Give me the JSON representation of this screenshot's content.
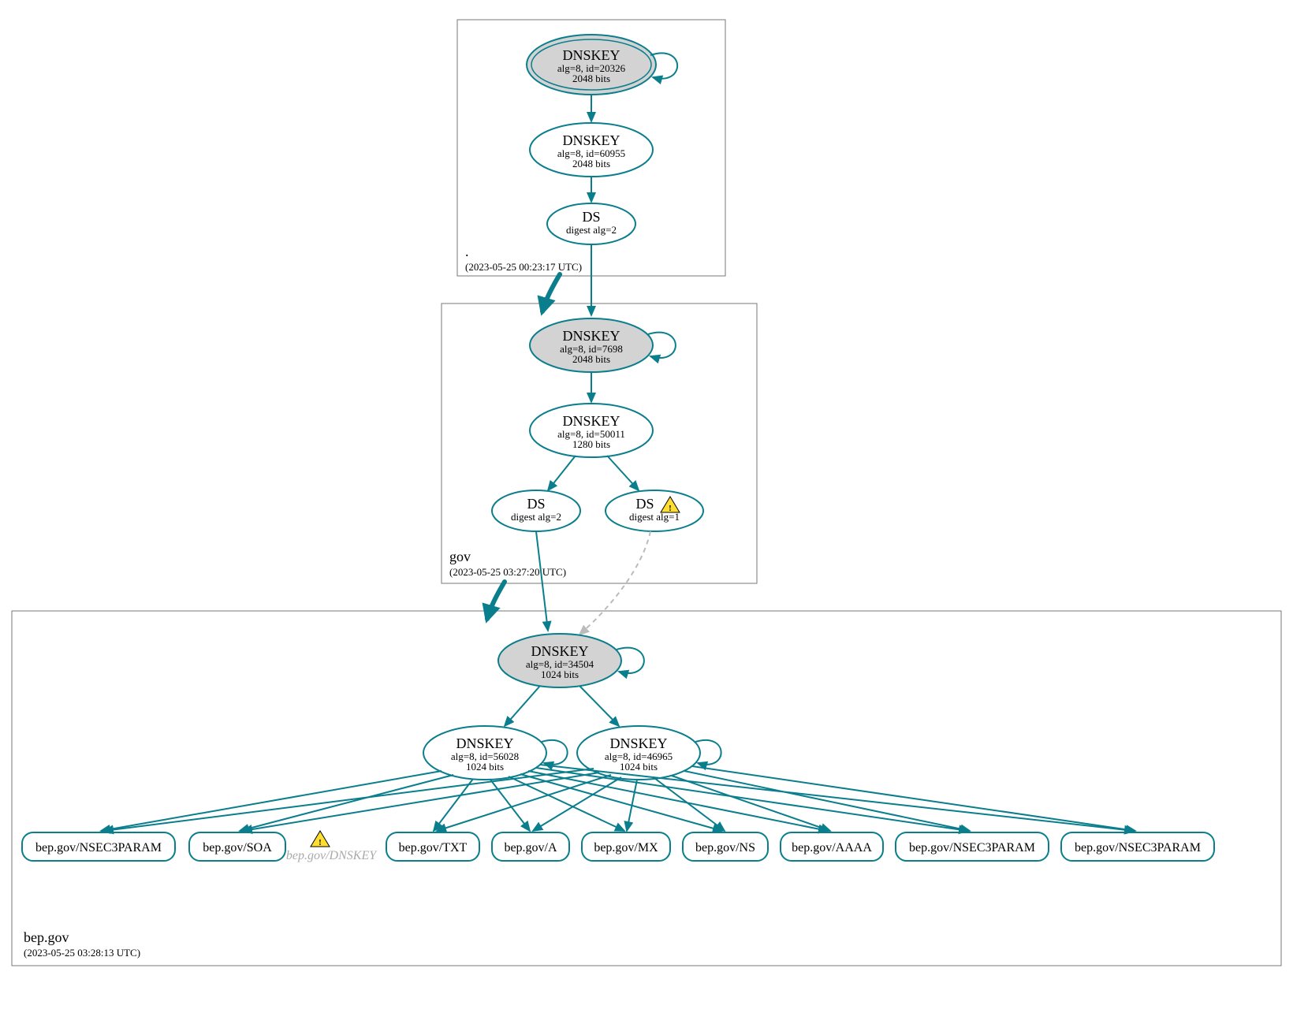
{
  "zones": [
    {
      "id": "root",
      "label": ".",
      "ts": "(2023-05-25 00:23:17 UTC)"
    },
    {
      "id": "gov",
      "label": "gov",
      "ts": "(2023-05-25 03:27:20 UTC)"
    },
    {
      "id": "bep",
      "label": "bep.gov",
      "ts": "(2023-05-25 03:28:13 UTC)"
    }
  ],
  "nodes": {
    "root_ksk": {
      "title": "DNSKEY",
      "l1": "alg=8, id=20326",
      "l2": "2048 bits"
    },
    "root_zsk": {
      "title": "DNSKEY",
      "l1": "alg=8, id=60955",
      "l2": "2048 bits"
    },
    "root_ds": {
      "title": "DS",
      "l1": "digest alg=2"
    },
    "gov_ksk": {
      "title": "DNSKEY",
      "l1": "alg=8, id=7698",
      "l2": "2048 bits"
    },
    "gov_zsk": {
      "title": "DNSKEY",
      "l1": "alg=8, id=50011",
      "l2": "1280 bits"
    },
    "gov_ds2": {
      "title": "DS",
      "l1": "digest alg=2"
    },
    "gov_ds1": {
      "title": "DS",
      "l1": "digest alg=1"
    },
    "bep_ksk": {
      "title": "DNSKEY",
      "l1": "alg=8, id=34504",
      "l2": "1024 bits"
    },
    "bep_zsk1": {
      "title": "DNSKEY",
      "l1": "alg=8, id=56028",
      "l2": "1024 bits"
    },
    "bep_zsk2": {
      "title": "DNSKEY",
      "l1": "alg=8, id=46965",
      "l2": "1024 bits"
    }
  },
  "rr": [
    {
      "id": "rr0",
      "label": "bep.gov/NSEC3PARAM"
    },
    {
      "id": "rr1",
      "label": "bep.gov/SOA"
    },
    {
      "id": "rr2",
      "label": "bep.gov/DNSKEY",
      "italic": true,
      "warn": true
    },
    {
      "id": "rr3",
      "label": "bep.gov/TXT"
    },
    {
      "id": "rr4",
      "label": "bep.gov/A"
    },
    {
      "id": "rr5",
      "label": "bep.gov/MX"
    },
    {
      "id": "rr6",
      "label": "bep.gov/NS"
    },
    {
      "id": "rr7",
      "label": "bep.gov/AAAA"
    },
    {
      "id": "rr8",
      "label": "bep.gov/NSEC3PARAM"
    },
    {
      "id": "rr9",
      "label": "bep.gov/NSEC3PARAM"
    }
  ],
  "colors": {
    "stroke": "#0a7e8c",
    "ksk_fill": "#d3d3d3",
    "warn": "#ffde2f"
  }
}
